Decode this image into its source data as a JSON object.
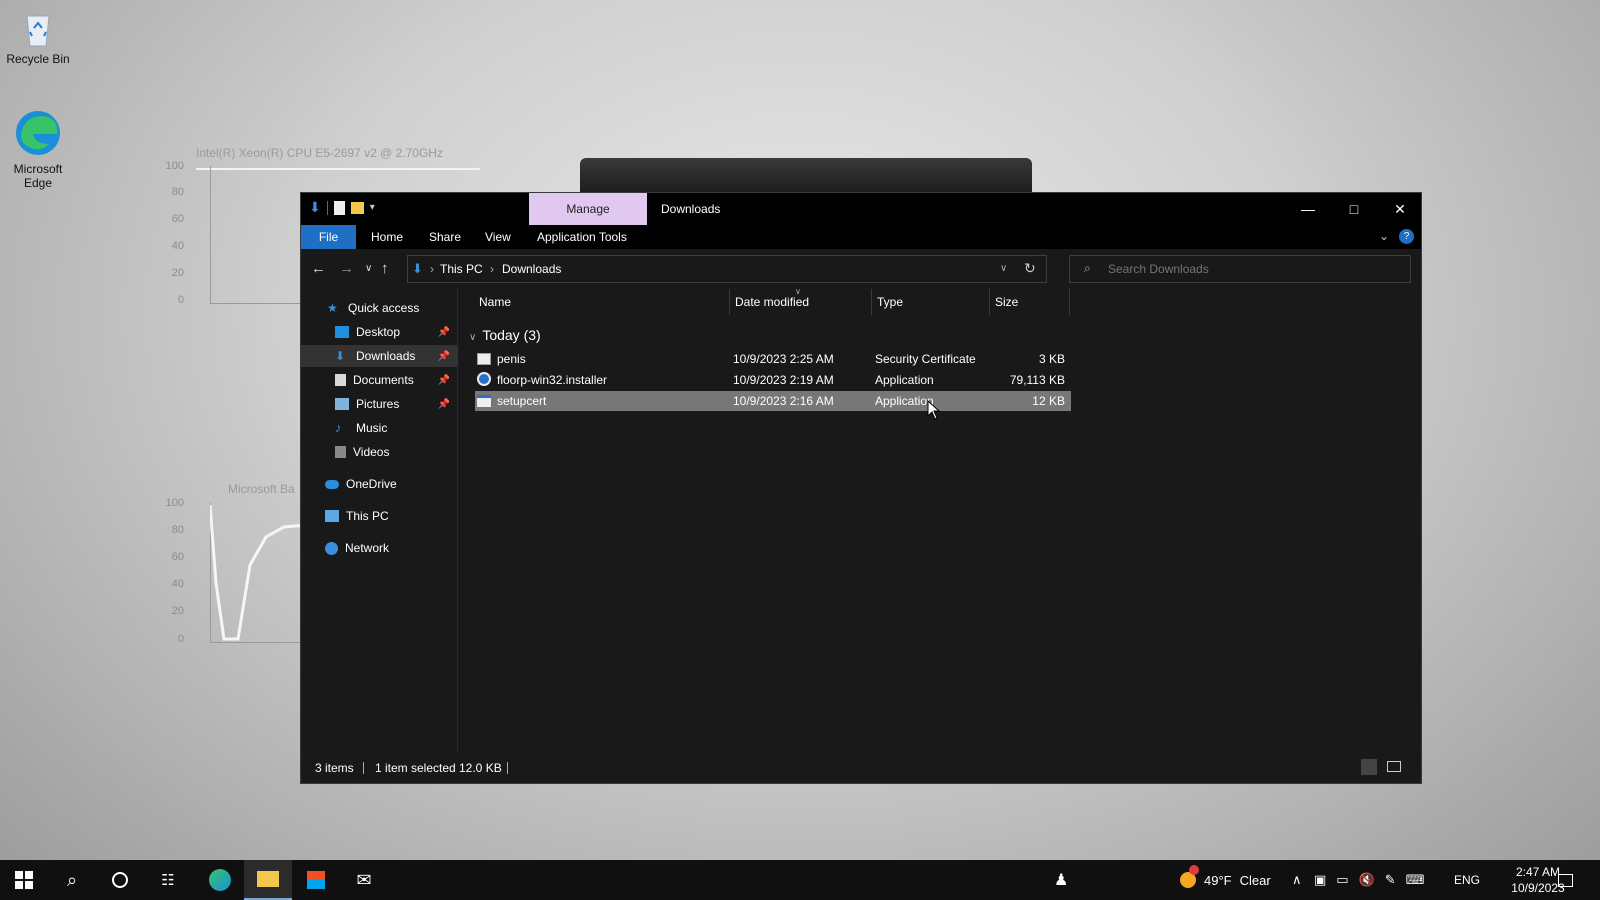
{
  "desktop": {
    "icons": [
      {
        "label": "Recycle Bin"
      },
      {
        "label": "Microsoft Edge"
      }
    ],
    "bg_widget_cpu_title": "Intel(R) Xeon(R) CPU E5-2697 v2 @ 2.70GHz",
    "bg_widget_ticks": [
      "100",
      "80",
      "60",
      "40",
      "20",
      "0"
    ],
    "bg_widget_2_title": "Microsoft Ba"
  },
  "window": {
    "title": "Downloads",
    "contextual_tab": "Manage",
    "ribbon_tabs": [
      "File",
      "Home",
      "Share",
      "View",
      "Application Tools"
    ],
    "breadcrumb": [
      "This PC",
      "Downloads"
    ],
    "search_placeholder": "Search Downloads",
    "nav": {
      "quick_access": "Quick access",
      "items": [
        {
          "label": "Desktop",
          "pinned": true
        },
        {
          "label": "Downloads",
          "pinned": true,
          "selected": true
        },
        {
          "label": "Documents",
          "pinned": true
        },
        {
          "label": "Pictures",
          "pinned": true
        },
        {
          "label": "Music",
          "pinned": false
        },
        {
          "label": "Videos",
          "pinned": false
        }
      ],
      "onedrive": "OneDrive",
      "this_pc": "This PC",
      "network": "Network"
    },
    "columns": [
      "Name",
      "Date modified",
      "Type",
      "Size"
    ],
    "group_label": "Today (3)",
    "files": [
      {
        "name": "penis",
        "date": "10/9/2023 2:25 AM",
        "type": "Security Certificate",
        "size": "3 KB"
      },
      {
        "name": "floorp-win32.installer",
        "date": "10/9/2023 2:19 AM",
        "type": "Application",
        "size": "79,113 KB"
      },
      {
        "name": "setupcert",
        "date": "10/9/2023 2:16 AM",
        "type": "Application",
        "size": "12 KB",
        "selected": true
      }
    ],
    "status": {
      "items": "3 items",
      "selected": "1 item selected",
      "size": "12.0 KB"
    }
  },
  "taskbar": {
    "weather": {
      "temp": "49°F",
      "condition": "Clear"
    },
    "language": "ENG",
    "time": "2:47 AM",
    "date": "10/9/2023"
  },
  "colors": {
    "accent": "#1f6fc4",
    "manage_tab": "#e1c8f0",
    "window_bg": "#191919"
  }
}
